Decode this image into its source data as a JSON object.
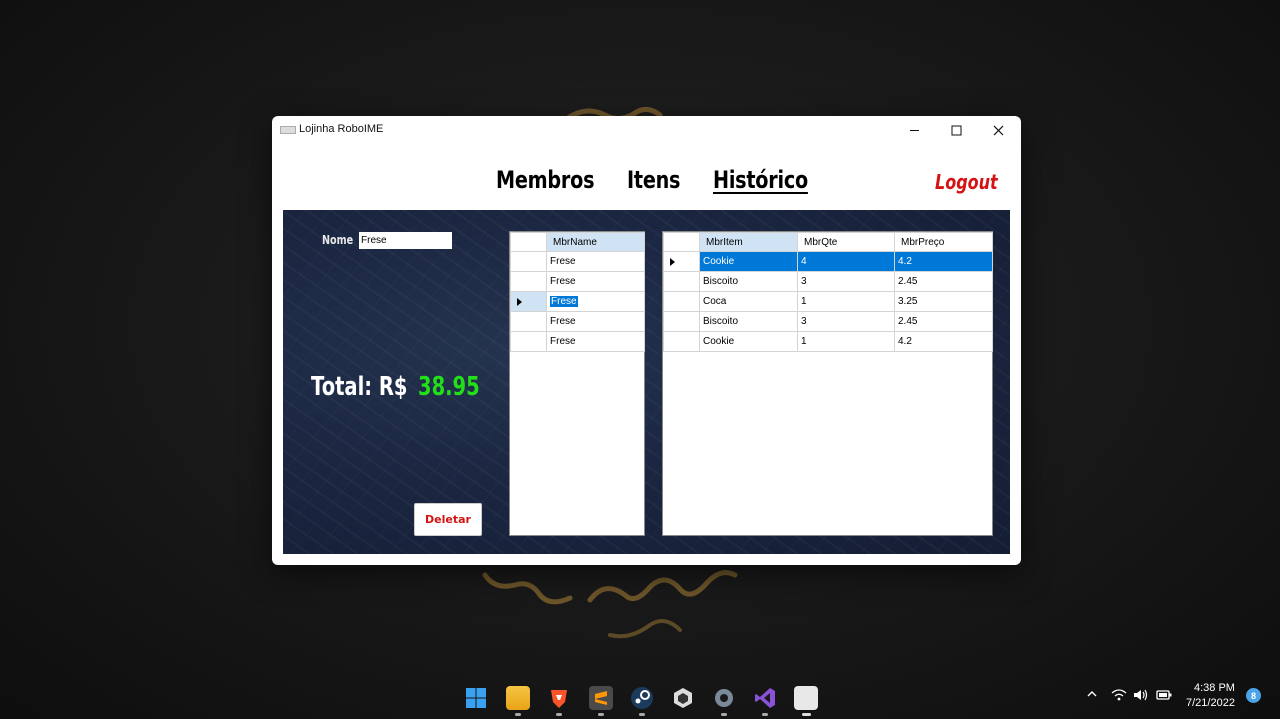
{
  "window": {
    "title": "Lojinha RoboIME"
  },
  "nav": {
    "membros": "Membros",
    "itens": "Itens",
    "historico": "Histórico",
    "logout": "Logout"
  },
  "form": {
    "nome_label": "Nome",
    "nome_value": "Frese",
    "total_label": "Total: R$",
    "total_value": "38.95",
    "deletar_label": "Deletar"
  },
  "members_grid": {
    "header": "MbrName",
    "rows": [
      "Frese",
      "Frese",
      "Frese",
      "Frese",
      "Frese"
    ],
    "selected_row": 3
  },
  "items_grid": {
    "headers": [
      "MbrItem",
      "MbrQte",
      "MbrPreço"
    ],
    "rows": [
      [
        "Cookie",
        "4",
        "4.2"
      ],
      [
        "Biscoito",
        "3",
        "2.45"
      ],
      [
        "Coca",
        "1",
        "3.25"
      ],
      [
        "Biscoito",
        "3",
        "2.45"
      ],
      [
        "Cookie",
        "1",
        "4.2"
      ]
    ],
    "selected_row": 1
  },
  "taskbar": {
    "icons": [
      "windows-start-icon",
      "file-explorer-icon",
      "brave-browser-icon",
      "sublime-text-icon",
      "steam-icon",
      "unity-icon",
      "settings-icon",
      "visual-studio-icon",
      "lojinha-app-icon"
    ],
    "time": "4:38 PM",
    "date": "7/21/2022",
    "notifications": "8"
  },
  "colors": {
    "accent": "#0078d7",
    "logout": "#d41414",
    "total": "#22e018",
    "panel": "#1a2540"
  }
}
